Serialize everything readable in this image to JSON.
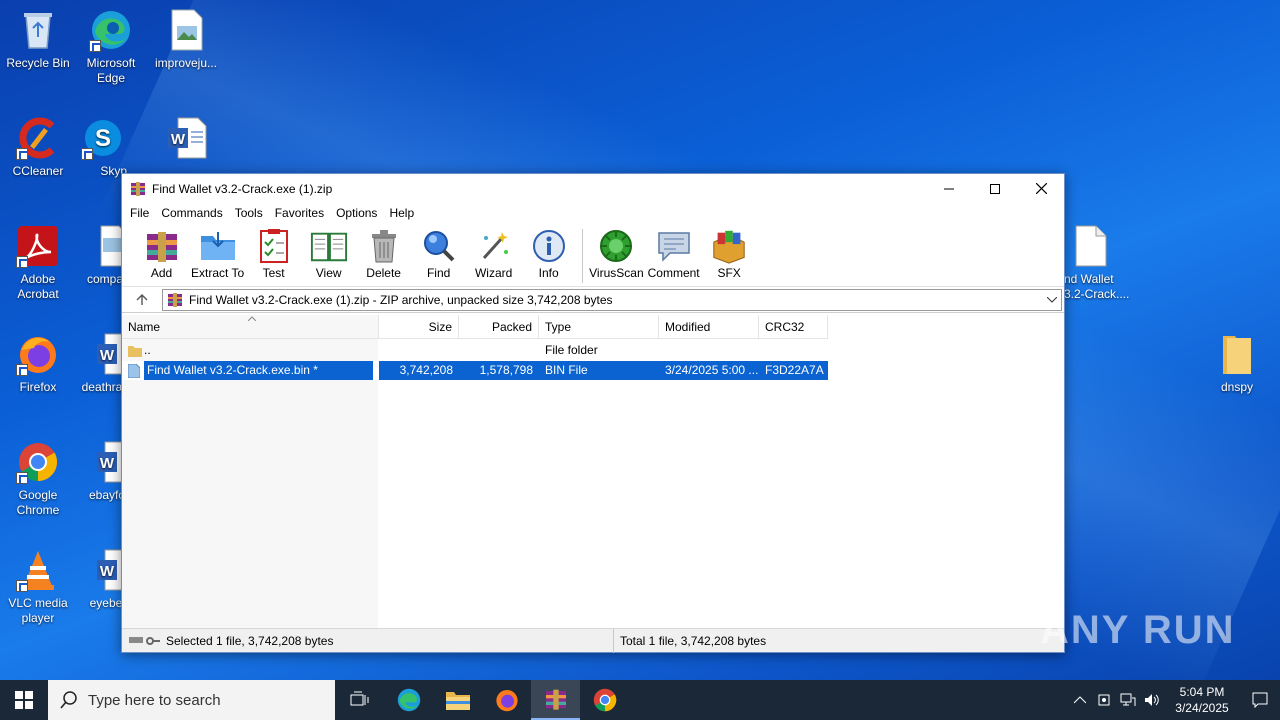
{
  "desktop": {
    "icons": [
      {
        "label": "Recycle Bin"
      },
      {
        "label": "Microsoft Edge"
      },
      {
        "label": "improveju..."
      },
      {
        "label": "CCleaner"
      },
      {
        "label": "Skyp"
      },
      {
        "label": "Adobe Acrobat"
      },
      {
        "label": "compar"
      },
      {
        "label": "Firefox"
      },
      {
        "label": "deathrap"
      },
      {
        "label": "Google Chrome"
      },
      {
        "label": "ebayfo"
      },
      {
        "label": "VLC media player"
      },
      {
        "label": "eyebea"
      },
      {
        "label": "nd Wallet\n3.2-Crack...."
      },
      {
        "label": "dnspy"
      }
    ]
  },
  "window": {
    "title": "Find Wallet v3.2-Crack.exe (1).zip",
    "menu": [
      "File",
      "Commands",
      "Tools",
      "Favorites",
      "Options",
      "Help"
    ],
    "toolbar": [
      "Add",
      "Extract To",
      "Test",
      "View",
      "Delete",
      "Find",
      "Wizard",
      "Info",
      "VirusScan",
      "Comment",
      "SFX"
    ],
    "address": "Find Wallet v3.2-Crack.exe (1).zip - ZIP archive, unpacked size 3,742,208 bytes",
    "columns": [
      "Name",
      "Size",
      "Packed",
      "Type",
      "Modified",
      "CRC32"
    ],
    "rows": [
      {
        "name": "..",
        "size": "",
        "packed": "",
        "type": "File folder",
        "modified": "",
        "crc": ""
      },
      {
        "name": "Find Wallet v3.2-Crack.exe.bin *",
        "size": "3,742,208",
        "packed": "1,578,798",
        "type": "BIN File",
        "modified": "3/24/2025 5:00 ...",
        "crc": "F3D22A7A"
      }
    ],
    "status_left": "Selected 1 file, 3,742,208 bytes",
    "status_right": "Total 1 file, 3,742,208 bytes"
  },
  "taskbar": {
    "search_placeholder": "Type here to search",
    "time": "5:04 PM",
    "date": "3/24/2025"
  },
  "watermark": "ANY RUN"
}
